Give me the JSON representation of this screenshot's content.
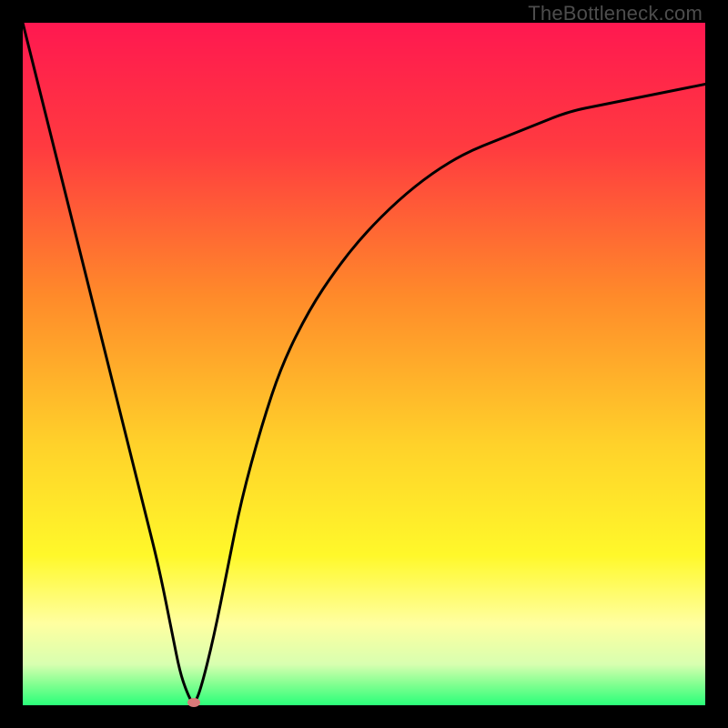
{
  "watermark": "TheBottleneck.com",
  "colors": {
    "top_red": "#ff1850",
    "mid_orange": "#ff8a2a",
    "mid_yellow": "#fff82a",
    "pale_yellow": "#ffffa0",
    "green": "#2aff7a",
    "frame": "#000000",
    "curve": "#000000",
    "marker": "#d87a79"
  },
  "chart_data": {
    "type": "line",
    "title": "",
    "xlabel": "",
    "ylabel": "",
    "xlim": [
      0,
      100
    ],
    "ylim": [
      0,
      100
    ],
    "x": [
      0,
      2,
      4,
      6,
      8,
      10,
      12,
      14,
      16,
      18,
      20,
      22,
      23,
      24,
      25,
      26,
      28,
      30,
      32,
      35,
      38,
      42,
      46,
      50,
      55,
      60,
      65,
      70,
      75,
      80,
      85,
      90,
      95,
      100
    ],
    "values": [
      100,
      92,
      84,
      76,
      68,
      60,
      52,
      44,
      36,
      28,
      20,
      10,
      5,
      2,
      0,
      2,
      10,
      20,
      30,
      41,
      50,
      58,
      64,
      69,
      74,
      78,
      81,
      83,
      85,
      87,
      88,
      89,
      90,
      91
    ],
    "minimum": {
      "x": 25,
      "y": 0
    },
    "note": "A single V-shaped bottleneck curve on a vertical rainbow (red→green) gradient. The left arm descends steeply and nearly linearly from top-left; the right arm rises with diminishing slope and levels off near the upper third on the right. The tiny red-pink ellipse marks the minimum at the bottom."
  }
}
